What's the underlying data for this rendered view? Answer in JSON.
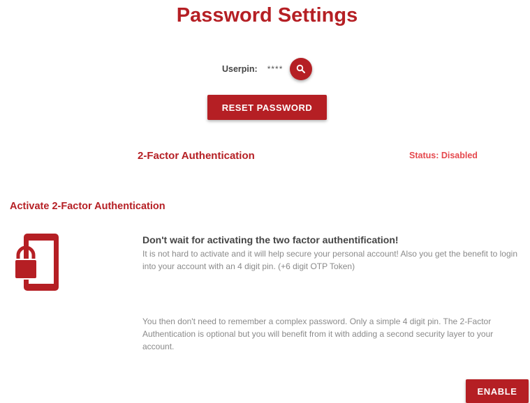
{
  "page": {
    "title": "Password Settings"
  },
  "userpin": {
    "label": "Userpin:",
    "value": "****",
    "search_icon": "search-icon"
  },
  "reset_button": {
    "label": "RESET PASSWORD"
  },
  "two_factor": {
    "title": "2-Factor Authentication",
    "status": "Status: Disabled"
  },
  "activate": {
    "title": "Activate 2-Factor Authentication",
    "icon": "phone-lock-icon",
    "heading": "Don't wait for activating the two factor authentification!",
    "paragraph1": "It is not hard to activate and it will help secure your personal account! Also you get the benefit to login into your account with an 4 digit pin. (+6 digit OTP Token)",
    "paragraph2": "You then don't need to remember a complex password. Only a simple 4 digit pin. The 2-Factor Authentication is optional but you will benefit from it with adding a second security layer to your account.",
    "enable_label": "ENABLE"
  },
  "colors": {
    "brand": "#b51f24",
    "status_disabled": "#e5484d"
  }
}
